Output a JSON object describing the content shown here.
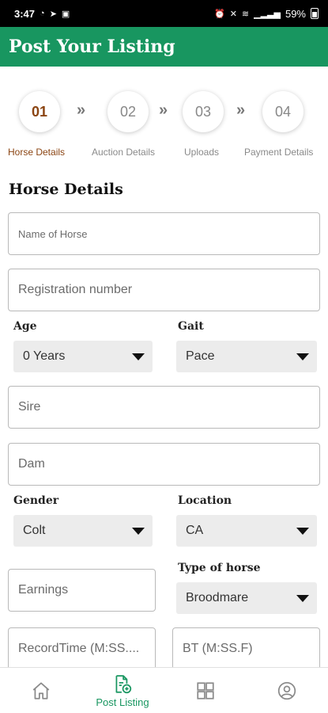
{
  "status_bar": {
    "time": "3:47",
    "left_icons": [
      "whatsapp-icon",
      "telegram-icon",
      "gallery-icon"
    ],
    "right_text": "59%",
    "battery_level": 0.59
  },
  "app_bar": {
    "title": "Post Your Listing"
  },
  "steps": [
    {
      "number": "01",
      "label": "Horse Details",
      "active": true
    },
    {
      "number": "02",
      "label": "Auction Details",
      "active": false
    },
    {
      "number": "03",
      "label": "Uploads",
      "active": false
    },
    {
      "number": "04",
      "label": "Payment Details",
      "active": false
    }
  ],
  "step_arrow": "»",
  "form": {
    "section_title": "Horse Details",
    "name_placeholder": "Name of Horse",
    "registration_placeholder": "Registration number",
    "age_label": "Age",
    "age_value": "0 Years",
    "gait_label": "Gait",
    "gait_value": "Pace",
    "sire_placeholder": "Sire",
    "dam_placeholder": "Dam",
    "gender_label": "Gender",
    "gender_value": "Colt",
    "location_label": "Location",
    "location_value": "CA",
    "earnings_placeholder": "Earnings",
    "type_label": "Type of horse",
    "type_value": "Broodmare",
    "record_time_placeholder": "RecordTime (M:SS....",
    "bt_placeholder": "BT (M:SS.F)"
  },
  "bottom_nav": {
    "items": [
      {
        "icon": "home-icon",
        "label": ""
      },
      {
        "icon": "post-listing-icon",
        "label": "Post Listing",
        "active": true
      },
      {
        "icon": "dashboard-icon",
        "label": ""
      },
      {
        "icon": "profile-icon",
        "label": ""
      }
    ]
  },
  "colors": {
    "primary": "#189660",
    "active_step": "#8b4513",
    "select_bg": "#ececec"
  }
}
